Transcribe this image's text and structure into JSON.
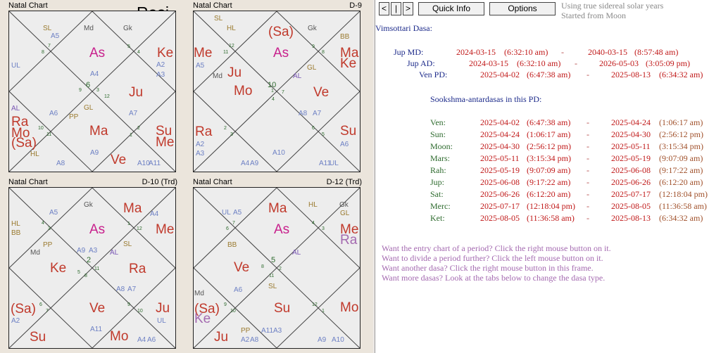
{
  "rasi_label": "Rasi",
  "charts": [
    {
      "title": "Natal Chart",
      "subtitle": "",
      "labels": [
        {
          "t": "SL",
          "c": "#9a7a2f",
          "s": 10
        },
        {
          "t": "A5",
          "c": "#6d80c4",
          "s": 10
        },
        {
          "t": "7",
          "c": "#2d6a2d",
          "s": 7
        },
        {
          "t": "8",
          "c": "#2d6a2d",
          "s": 7
        },
        {
          "t": "Md",
          "c": "#555555",
          "s": 10
        },
        {
          "t": "Gk",
          "c": "#555555",
          "s": 10
        },
        {
          "t": "5",
          "c": "#2d6a2d",
          "s": 7
        },
        {
          "t": "4",
          "c": "#2d6a2d",
          "s": 7
        },
        {
          "t": "As",
          "c": "#c8208c",
          "s": 19
        },
        {
          "t": "Ke",
          "c": "#c0392b",
          "s": 19
        },
        {
          "t": "A2",
          "c": "#6d80c4",
          "s": 10
        },
        {
          "t": "A3",
          "c": "#6d80c4",
          "s": 10
        },
        {
          "t": "UL",
          "c": "#6d80c4",
          "s": 10
        },
        {
          "t": "A4",
          "c": "#6d80c4",
          "s": 10
        },
        {
          "t": "9",
          "c": "#2d6a2d",
          "s": 7
        },
        {
          "t": "6",
          "c": "#2d6a2d",
          "s": 11
        },
        {
          "t": "3",
          "c": "#2d6a2d",
          "s": 7
        },
        {
          "t": "12",
          "c": "#2d6a2d",
          "s": 7
        },
        {
          "t": "GL",
          "c": "#9a7a2f",
          "s": 10
        },
        {
          "t": "Ju",
          "c": "#c0392b",
          "s": 19
        },
        {
          "t": "AL",
          "c": "#7a58b5",
          "s": 10
        },
        {
          "t": "Ra",
          "c": "#c0392b",
          "s": 19
        },
        {
          "t": "Mo",
          "c": "#c0392b",
          "s": 19
        },
        {
          "t": "(Sa)",
          "c": "#c0392b",
          "s": 19
        },
        {
          "t": "A6",
          "c": "#6d80c4",
          "s": 10
        },
        {
          "t": "PP",
          "c": "#9a7a2f",
          "s": 10
        },
        {
          "t": "10",
          "c": "#2d6a2d",
          "s": 7
        },
        {
          "t": "11",
          "c": "#2d6a2d",
          "s": 7
        },
        {
          "t": "Ma",
          "c": "#c0392b",
          "s": 19
        },
        {
          "t": "A7",
          "c": "#6d80c4",
          "s": 10
        },
        {
          "t": "2",
          "c": "#2d6a2d",
          "s": 7
        },
        {
          "t": "1",
          "c": "#2d6a2d",
          "s": 7
        },
        {
          "t": "Su",
          "c": "#c0392b",
          "s": 19
        },
        {
          "t": "Me",
          "c": "#c0392b",
          "s": 19
        },
        {
          "t": "HL",
          "c": "#9a7a2f",
          "s": 10
        },
        {
          "t": "A8",
          "c": "#6d80c4",
          "s": 10
        },
        {
          "t": "A9",
          "c": "#6d80c4",
          "s": 10
        },
        {
          "t": "Ve",
          "c": "#c0392b",
          "s": 19
        },
        {
          "t": "A10",
          "c": "#6d80c4",
          "s": 10
        },
        {
          "t": "A11",
          "c": "#6d80c4",
          "s": 10
        }
      ]
    },
    {
      "title": "Natal Chart",
      "subtitle": "D-9",
      "labels": [
        {
          "t": "SL",
          "c": "#9a7a2f",
          "s": 10
        },
        {
          "t": "HL",
          "c": "#9a7a2f",
          "s": 10
        },
        {
          "t": "12",
          "c": "#2d6a2d",
          "s": 7
        },
        {
          "t": "11",
          "c": "#2d6a2d",
          "s": 7
        },
        {
          "t": "(Sa)",
          "c": "#c0392b",
          "s": 19
        },
        {
          "t": "Gk",
          "c": "#555555",
          "s": 10
        },
        {
          "t": "BB",
          "c": "#9a7a2f",
          "s": 10
        },
        {
          "t": "9",
          "c": "#2d6a2d",
          "s": 7
        },
        {
          "t": "8",
          "c": "#2d6a2d",
          "s": 7
        },
        {
          "t": "As",
          "c": "#c8208c",
          "s": 19
        },
        {
          "t": "Me",
          "c": "#c0392b",
          "s": 19
        },
        {
          "t": "Ma",
          "c": "#c0392b",
          "s": 19
        },
        {
          "t": "Ke",
          "c": "#c0392b",
          "s": 19
        },
        {
          "t": "A5",
          "c": "#6d80c4",
          "s": 10
        },
        {
          "t": "Ju",
          "c": "#c0392b",
          "s": 19
        },
        {
          "t": "Md",
          "c": "#555555",
          "s": 10
        },
        {
          "t": "GL",
          "c": "#9a7a2f",
          "s": 10
        },
        {
          "t": "AL",
          "c": "#7a58b5",
          "s": 10
        },
        {
          "t": "Mo",
          "c": "#c0392b",
          "s": 19
        },
        {
          "t": "1",
          "c": "#2d6a2d",
          "s": 7
        },
        {
          "t": "10",
          "c": "#2d6a2d",
          "s": 11
        },
        {
          "t": "7",
          "c": "#2d6a2d",
          "s": 7
        },
        {
          "t": "4",
          "c": "#2d6a2d",
          "s": 7
        },
        {
          "t": "Ve",
          "c": "#c0392b",
          "s": 19
        },
        {
          "t": "A8",
          "c": "#6d80c4",
          "s": 10
        },
        {
          "t": "A7",
          "c": "#6d80c4",
          "s": 10
        },
        {
          "t": "Ra",
          "c": "#c0392b",
          "s": 19
        },
        {
          "t": "2",
          "c": "#2d6a2d",
          "s": 7
        },
        {
          "t": "3",
          "c": "#2d6a2d",
          "s": 7
        },
        {
          "t": "6",
          "c": "#2d6a2d",
          "s": 7
        },
        {
          "t": "5",
          "c": "#2d6a2d",
          "s": 7
        },
        {
          "t": "Su",
          "c": "#c0392b",
          "s": 19
        },
        {
          "t": "A2",
          "c": "#6d80c4",
          "s": 10
        },
        {
          "t": "A3",
          "c": "#6d80c4",
          "s": 10
        },
        {
          "t": "A6",
          "c": "#6d80c4",
          "s": 10
        },
        {
          "t": "A10",
          "c": "#6d80c4",
          "s": 10
        },
        {
          "t": "A4",
          "c": "#6d80c4",
          "s": 10
        },
        {
          "t": "A9",
          "c": "#6d80c4",
          "s": 10
        },
        {
          "t": "A11",
          "c": "#6d80c4",
          "s": 10
        },
        {
          "t": "UL",
          "c": "#6d80c4",
          "s": 10
        }
      ]
    },
    {
      "title": "Natal Chart",
      "subtitle": "D-10 (Trd)",
      "labels": [
        {
          "t": "A5",
          "c": "#6d80c4",
          "s": 10
        },
        {
          "t": "Gk",
          "c": "#555555",
          "s": 10
        },
        {
          "t": "Ma",
          "c": "#c0392b",
          "s": 19
        },
        {
          "t": "A4",
          "c": "#6d80c4",
          "s": 10
        },
        {
          "t": "HL",
          "c": "#9a7a2f",
          "s": 10
        },
        {
          "t": "BB",
          "c": "#9a7a2f",
          "s": 10
        },
        {
          "t": "4",
          "c": "#2d6a2d",
          "s": 7
        },
        {
          "t": "3",
          "c": "#2d6a2d",
          "s": 7
        },
        {
          "t": "As",
          "c": "#c8208c",
          "s": 19
        },
        {
          "t": "1",
          "c": "#2d6a2d",
          "s": 7
        },
        {
          "t": "12",
          "c": "#2d6a2d",
          "s": 7
        },
        {
          "t": "Me",
          "c": "#c0392b",
          "s": 19
        },
        {
          "t": "PP",
          "c": "#9a7a2f",
          "s": 10
        },
        {
          "t": "Md",
          "c": "#555555",
          "s": 10
        },
        {
          "t": "A9",
          "c": "#6d80c4",
          "s": 10
        },
        {
          "t": "A3",
          "c": "#6d80c4",
          "s": 10
        },
        {
          "t": "SL",
          "c": "#9a7a2f",
          "s": 10
        },
        {
          "t": "AL",
          "c": "#7a58b5",
          "s": 10
        },
        {
          "t": "5",
          "c": "#2d6a2d",
          "s": 7
        },
        {
          "t": "2",
          "c": "#2d6a2d",
          "s": 11
        },
        {
          "t": "11",
          "c": "#2d6a2d",
          "s": 7
        },
        {
          "t": "8",
          "c": "#2d6a2d",
          "s": 7
        },
        {
          "t": "Ke",
          "c": "#c0392b",
          "s": 19
        },
        {
          "t": "Ra",
          "c": "#c0392b",
          "s": 19
        },
        {
          "t": "A8",
          "c": "#6d80c4",
          "s": 10
        },
        {
          "t": "A7",
          "c": "#6d80c4",
          "s": 10
        },
        {
          "t": "(Sa)",
          "c": "#c0392b",
          "s": 19
        },
        {
          "t": "6",
          "c": "#2d6a2d",
          "s": 7
        },
        {
          "t": "7",
          "c": "#2d6a2d",
          "s": 7
        },
        {
          "t": "Ve",
          "c": "#c0392b",
          "s": 19
        },
        {
          "t": "9",
          "c": "#2d6a2d",
          "s": 7
        },
        {
          "t": "10",
          "c": "#2d6a2d",
          "s": 7
        },
        {
          "t": "Ju",
          "c": "#c0392b",
          "s": 19
        },
        {
          "t": "A2",
          "c": "#6d80c4",
          "s": 10
        },
        {
          "t": "UL",
          "c": "#6d80c4",
          "s": 10
        },
        {
          "t": "Su",
          "c": "#c0392b",
          "s": 19
        },
        {
          "t": "A11",
          "c": "#6d80c4",
          "s": 10
        },
        {
          "t": "Mo",
          "c": "#c0392b",
          "s": 19
        },
        {
          "t": "A4",
          "c": "#6d80c4",
          "s": 10
        },
        {
          "t": "A6",
          "c": "#6d80c4",
          "s": 10
        }
      ]
    },
    {
      "title": "Natal Chart",
      "subtitle": "D-12 (Trd)",
      "labels": [
        {
          "t": "UL",
          "c": "#6d80c4",
          "s": 10
        },
        {
          "t": "A5",
          "c": "#6d80c4",
          "s": 10
        },
        {
          "t": "Ma",
          "c": "#c0392b",
          "s": 19
        },
        {
          "t": "HL",
          "c": "#9a7a2f",
          "s": 10
        },
        {
          "t": "Gk",
          "c": "#555555",
          "s": 10
        },
        {
          "t": "GL",
          "c": "#9a7a2f",
          "s": 10
        },
        {
          "t": "7",
          "c": "#2d6a2d",
          "s": 7
        },
        {
          "t": "6",
          "c": "#2d6a2d",
          "s": 7
        },
        {
          "t": "As",
          "c": "#c8208c",
          "s": 19
        },
        {
          "t": "4",
          "c": "#2d6a2d",
          "s": 7
        },
        {
          "t": "3",
          "c": "#2d6a2d",
          "s": 7
        },
        {
          "t": "Me",
          "c": "#c0392b",
          "s": 19
        },
        {
          "t": "Ra",
          "c": "#a46ab0",
          "s": 19
        },
        {
          "t": "BB",
          "c": "#9a7a2f",
          "s": 10
        },
        {
          "t": "Ve",
          "c": "#c0392b",
          "s": 19
        },
        {
          "t": "8",
          "c": "#2d6a2d",
          "s": 7
        },
        {
          "t": "5",
          "c": "#2d6a2d",
          "s": 11
        },
        {
          "t": "2",
          "c": "#2d6a2d",
          "s": 7
        },
        {
          "t": "11",
          "c": "#2d6a2d",
          "s": 7
        },
        {
          "t": "SL",
          "c": "#9a7a2f",
          "s": 10
        },
        {
          "t": "A6",
          "c": "#6d80c4",
          "s": 10
        },
        {
          "t": "Md",
          "c": "#555555",
          "s": 10
        },
        {
          "t": "(Sa)",
          "c": "#c0392b",
          "s": 19
        },
        {
          "t": "Ke",
          "c": "#a46ab0",
          "s": 19
        },
        {
          "t": "9",
          "c": "#2d6a2d",
          "s": 7
        },
        {
          "t": "10",
          "c": "#2d6a2d",
          "s": 7
        },
        {
          "t": "Su",
          "c": "#c0392b",
          "s": 19
        },
        {
          "t": "12",
          "c": "#2d6a2d",
          "s": 7
        },
        {
          "t": "1",
          "c": "#2d6a2d",
          "s": 7
        },
        {
          "t": "Mo",
          "c": "#c0392b",
          "s": 19
        },
        {
          "t": "AL",
          "c": "#7a58b5",
          "s": 10
        },
        {
          "t": "PP",
          "c": "#9a7a2f",
          "s": 10
        },
        {
          "t": "Ju",
          "c": "#c0392b",
          "s": 19
        },
        {
          "t": "A2",
          "c": "#6d80c4",
          "s": 10
        },
        {
          "t": "A8",
          "c": "#6d80c4",
          "s": 10
        },
        {
          "t": "A11",
          "c": "#6d80c4",
          "s": 10
        },
        {
          "t": "A3",
          "c": "#6d80c4",
          "s": 10
        },
        {
          "t": "A9",
          "c": "#6d80c4",
          "s": 10
        },
        {
          "t": "A10",
          "c": "#6d80c4",
          "s": 10
        }
      ]
    }
  ],
  "toolbar": {
    "prev": "<",
    "mid": "|",
    "next": ">",
    "quick_info": "Quick Info",
    "options": "Options",
    "note_line1": "Using true sidereal solar years",
    "note_line2": "Started from Moon"
  },
  "dasa": {
    "title": "Vimsottari Dasa:",
    "md": {
      "label": "Jup MD:",
      "start_date": "2024-03-15",
      "start_time": "(6:32:10 am)",
      "sep": "-",
      "end_date": "2040-03-15",
      "end_time": "(8:57:48 am)"
    },
    "ad": {
      "label": "Jup AD:",
      "start_date": "2024-03-15",
      "start_time": "(6:32:10 am)",
      "sep": "-",
      "end_date": "2026-05-03",
      "end_time": "(3:05:09 pm)"
    },
    "pd": {
      "label": "Ven PD:",
      "start_date": "2025-04-02",
      "start_time": "(6:47:38 am)",
      "sep": "-",
      "end_date": "2025-08-13",
      "end_time": "(6:34:32 am)"
    },
    "sookshma_title": "Sookshma-antardasas in this PD:",
    "rows": [
      {
        "label": "Ven:",
        "start_date": "2025-04-02",
        "start_time": "(6:47:38 am)",
        "sep": "-",
        "end_date": "2025-04-24",
        "end_time": "(1:06:17 am)"
      },
      {
        "label": "Sun:",
        "start_date": "2025-04-24",
        "start_time": "(1:06:17 am)",
        "sep": "-",
        "end_date": "2025-04-30",
        "end_time": "(2:56:12 pm)"
      },
      {
        "label": "Moon:",
        "start_date": "2025-04-30",
        "start_time": "(2:56:12 pm)",
        "sep": "-",
        "end_date": "2025-05-11",
        "end_time": "(3:15:34 pm)"
      },
      {
        "label": "Mars:",
        "start_date": "2025-05-11",
        "start_time": "(3:15:34 pm)",
        "sep": "-",
        "end_date": "2025-05-19",
        "end_time": "(9:07:09 am)"
      },
      {
        "label": "Rah:",
        "start_date": "2025-05-19",
        "start_time": "(9:07:09 am)",
        "sep": "-",
        "end_date": "2025-06-08",
        "end_time": "(9:17:22 am)"
      },
      {
        "label": "Jup:",
        "start_date": "2025-06-08",
        "start_time": "(9:17:22 am)",
        "sep": "-",
        "end_date": "2025-06-26",
        "end_time": "(6:12:20 am)"
      },
      {
        "label": "Sat:",
        "start_date": "2025-06-26",
        "start_time": "(6:12:20 am)",
        "sep": "-",
        "end_date": "2025-07-17",
        "end_time": "(12:18:04 pm)"
      },
      {
        "label": "Merc:",
        "start_date": "2025-07-17",
        "start_time": "(12:18:04 pm)",
        "sep": "-",
        "end_date": "2025-08-05",
        "end_time": "(11:36:58 am)"
      },
      {
        "label": "Ket:",
        "start_date": "2025-08-05",
        "start_time": "(11:36:58 am)",
        "sep": "-",
        "end_date": "2025-08-13",
        "end_time": "(6:34:32 am)"
      }
    ]
  },
  "help": [
    "Want the entry chart of a period? Click the right mouse button on it.",
    "Want to divide a period further? Click the left mouse button on it.",
    "Want another dasa? Click the right mouse button in this frame.",
    "Want more dasas? Look at the tabs below to change the dasa type."
  ]
}
